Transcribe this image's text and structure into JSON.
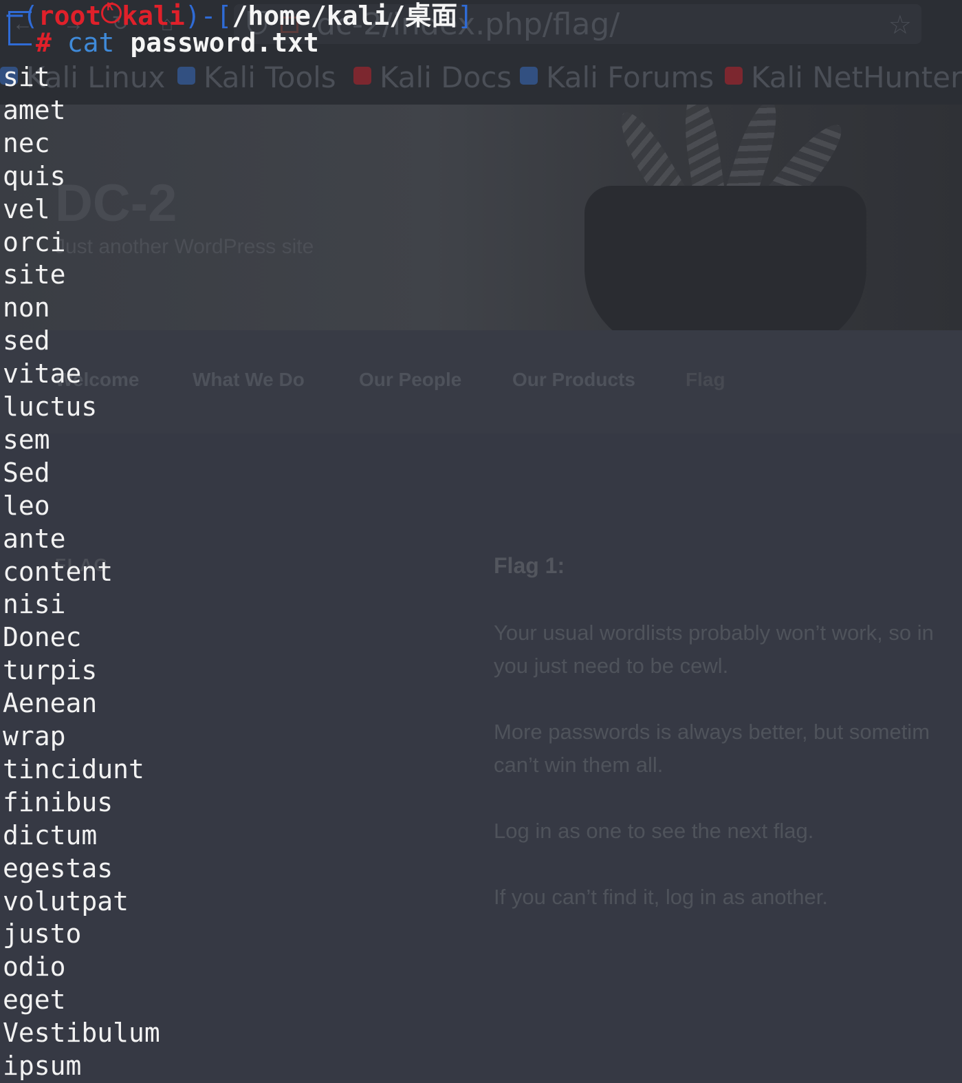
{
  "browser": {
    "url": "dc-2/index.php/flag/",
    "bookmarks": [
      {
        "label": "Kali Linux",
        "color": "#3b7be0"
      },
      {
        "label": "Kali Tools",
        "color": "#3b7be0"
      },
      {
        "label": "Kali Docs",
        "color": "#e0202a"
      },
      {
        "label": "Kali Forums",
        "color": "#3b7be0"
      },
      {
        "label": "Kali NetHunter",
        "color": "#e0202a"
      }
    ],
    "site_title": "DC-2",
    "site_description": "Just another WordPress site",
    "menu": [
      "Welcome",
      "What We Do",
      "Our People",
      "Our Products",
      "Flag"
    ],
    "page_heading": "FLAG",
    "post_title": "Flag 1:",
    "post_paragraphs": [
      [
        "Your usual wordlists probably won’t work, so in",
        "you just need to be cewl."
      ],
      [
        "More passwords is always better, but sometim",
        "can’t win them all."
      ],
      [
        "Log in as one to see the next flag."
      ],
      [
        "If you can’t find it, log in as another."
      ]
    ]
  },
  "terminal": {
    "prompt_user": "root",
    "prompt_host": "kali",
    "prompt_path": "/home/kali/桌面",
    "prompt_symbol": "#",
    "command": "cat",
    "argument": "password.txt",
    "output_lines": [
      "sit",
      "amet",
      "nec",
      "quis",
      "vel",
      "orci",
      "site",
      "non",
      "sed",
      "vitae",
      "luctus",
      "sem",
      "Sed",
      "leo",
      "ante",
      "content",
      "nisi",
      "Donec",
      "turpis",
      "Aenean",
      "wrap",
      "tincidunt",
      "finibus",
      "dictum",
      "egestas",
      "volutpat",
      "justo",
      "odio",
      "eget",
      "Vestibulum",
      "ipsum"
    ]
  }
}
